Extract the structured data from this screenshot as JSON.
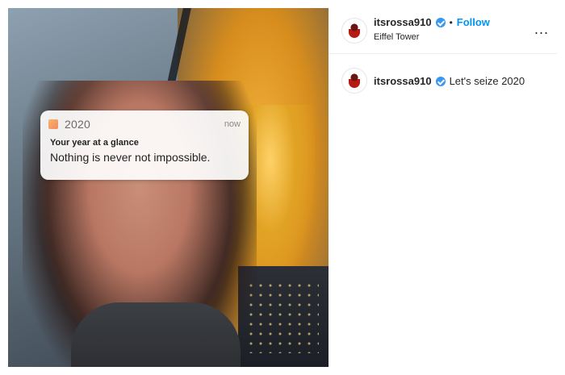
{
  "media": {
    "notification": {
      "app_name": "2020",
      "time": "now",
      "title": "Your year at a glance",
      "body": "Nothing is never not impossible."
    }
  },
  "post": {
    "username": "itsrossa910",
    "verified": true,
    "follow_label": "Follow",
    "location": "Eiffel Tower",
    "more_label": "...",
    "caption_text": "Let's seize 2020"
  },
  "colors": {
    "follow_blue": "#0095f6",
    "verified_blue": "#3897f0"
  }
}
